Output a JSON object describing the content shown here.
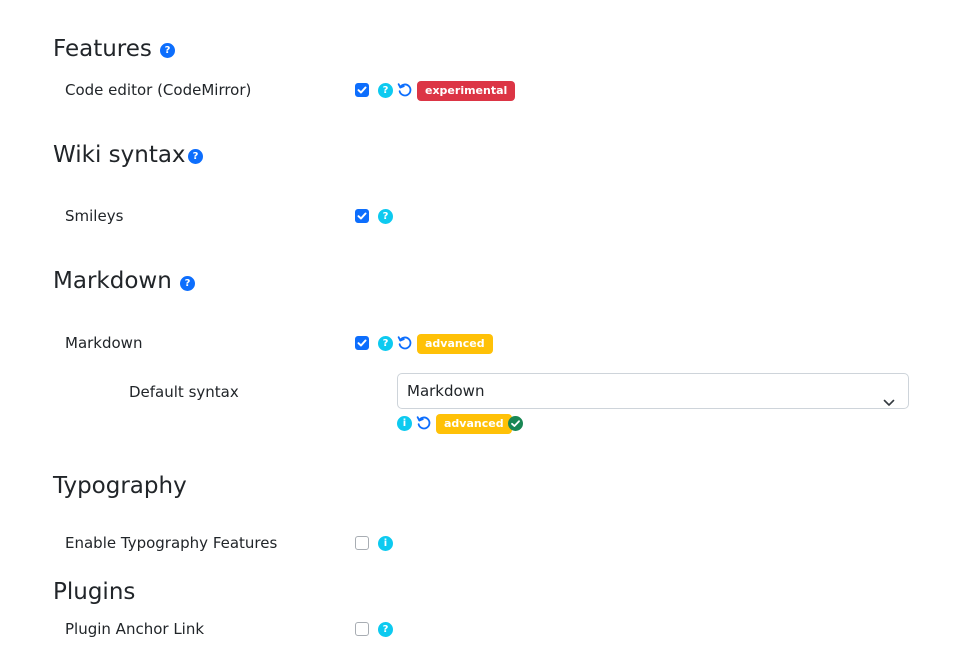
{
  "sections": {
    "features": {
      "title": "Features",
      "help_icon": "question-circle-icon",
      "prefs": {
        "codemirror": {
          "label": "Code editor (CodeMirror)",
          "checked": true,
          "badge": "experimental",
          "badge_color": "#dc3545"
        }
      }
    },
    "wiki_syntax": {
      "title": "Wiki syntax",
      "help_icon": "question-circle-icon",
      "prefs": {
        "smileys": {
          "label": "Smileys",
          "checked": true
        }
      }
    },
    "markdown": {
      "title": "Markdown",
      "help_icon": "question-circle-icon",
      "prefs": {
        "markdown": {
          "label": "Markdown",
          "checked": true,
          "badge": "advanced",
          "badge_color": "#ffc107"
        },
        "default_syntax": {
          "label": "Default syntax",
          "selected": "Markdown",
          "badge": "advanced",
          "badge_color": "#ffc107"
        }
      }
    },
    "typography": {
      "title": "Typography",
      "prefs": {
        "typography_features": {
          "label": "Enable Typography Features",
          "checked": false
        }
      }
    },
    "plugins": {
      "title": "Plugins",
      "prefs": {
        "plugin_anchor_link": {
          "label": "Plugin Anchor Link",
          "checked": false
        }
      }
    }
  },
  "icons": {
    "help": "question-circle-icon",
    "info": "info-circle-icon",
    "reset": "reset-icon",
    "ok": "check-circle-icon",
    "dropdown": "chevron-down-icon"
  },
  "colors": {
    "primary": "#0d6efd",
    "info": "#0dcaf0",
    "danger": "#dc3545",
    "warning": "#ffc107",
    "success": "#198754"
  }
}
